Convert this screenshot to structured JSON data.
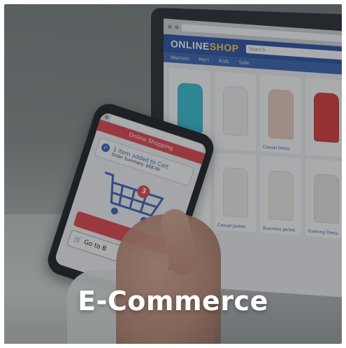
{
  "caption": "E-Commerce",
  "laptop_screen": {
    "logo_prefix": "ONLINE",
    "logo_suffix": "SHOP",
    "search_placeholder": "Search",
    "nav": [
      "Women",
      "Men",
      "Kids",
      "Sale"
    ],
    "products": [
      {
        "color": "#3bc3d6",
        "caption": ""
      },
      {
        "color": "#f4f4f4",
        "caption": ""
      },
      {
        "color": "#f1cfc0",
        "caption": "Casual Dress"
      },
      {
        "color": "#e13b3b",
        "caption": ""
      },
      {
        "color": "#ffffff",
        "caption": ""
      },
      {
        "color": "#f3f3f3",
        "caption": "Casual Jacket"
      },
      {
        "color": "#f6efe8",
        "caption": "Business Jacket"
      },
      {
        "color": "#e8e8e8",
        "caption": "Evening Dress"
      }
    ]
  },
  "phone_screen": {
    "header": "Online Shopping",
    "added_message": "1 item added to Cart",
    "order_summary": "Order Summary: $68.00",
    "cart_count": "3",
    "goto_label": "Go to B"
  },
  "colors": {
    "shop_blue": "#2e55a6",
    "accent_red": "#e5484d"
  }
}
